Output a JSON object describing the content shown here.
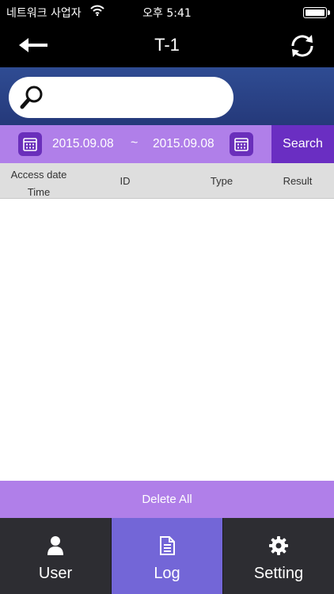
{
  "status_bar": {
    "carrier": "네트워크 사업자",
    "time": "오후 5:41"
  },
  "nav": {
    "title": "T-1"
  },
  "search": {
    "placeholder": ""
  },
  "date_filter": {
    "start_date": "2015.09.08",
    "separator": "~",
    "end_date": "2015.09.08",
    "search_label": "Search"
  },
  "table": {
    "columns": {
      "access_date": "Access date",
      "time": "Time",
      "id": "ID",
      "type": "Type",
      "result": "Result"
    },
    "rows": []
  },
  "actions": {
    "delete_all": "Delete All"
  },
  "tabs": [
    {
      "label": "User",
      "icon": "user-icon"
    },
    {
      "label": "Log",
      "icon": "document-icon",
      "active": true
    },
    {
      "label": "Setting",
      "icon": "gear-icon"
    }
  ],
  "colors": {
    "accent_light": "#b07fe9",
    "accent_dark": "#6a2ec2",
    "header_blue": "#2f4c93",
    "tab_active": "#7366d7",
    "tab_bg": "#2d2d32"
  }
}
